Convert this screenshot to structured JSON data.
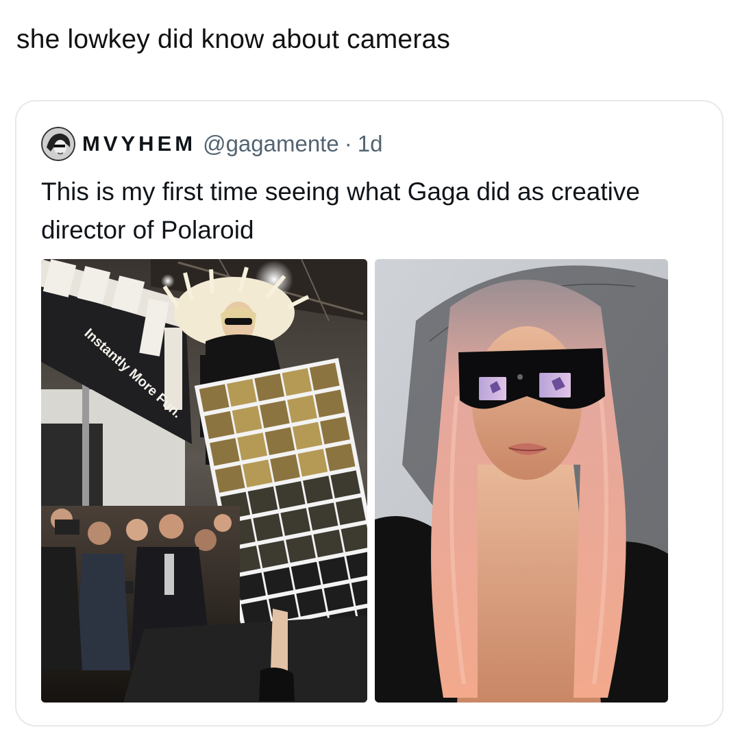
{
  "caption": "she lowkey did know about cameras",
  "quoted_tweet": {
    "display_name": "MVYHEM",
    "handle": "@gagamente",
    "separator": "·",
    "age": "1d",
    "text": "This is my first time seeing what Gaga did as creative director of Polaroid",
    "photos": [
      {
        "banner_text": "Instantly More Fun."
      },
      {}
    ]
  },
  "colors": {
    "text_primary": "#0f1419",
    "text_secondary": "#536471",
    "card_border": "#e6e8ea"
  },
  "icons": {
    "avatar": "profile-photo-avatar"
  }
}
